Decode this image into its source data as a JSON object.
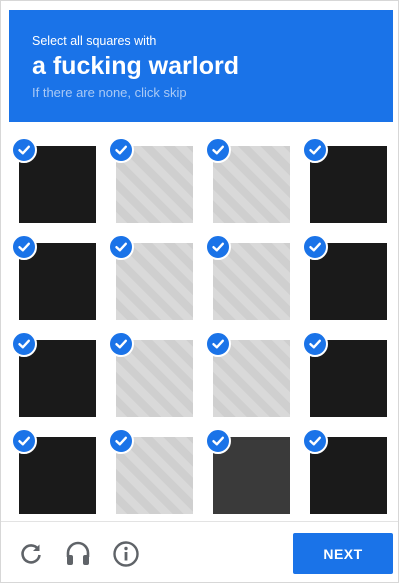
{
  "header": {
    "instruction": "Select all squares with",
    "target": "a fucking warlord",
    "hint": "If there are none, click skip"
  },
  "grid": {
    "rows": 4,
    "cols": 4,
    "selected": [
      true,
      true,
      true,
      true,
      true,
      true,
      true,
      true,
      true,
      true,
      true,
      true,
      true,
      true,
      true,
      true
    ],
    "tile_tone": [
      "dark",
      "light",
      "light",
      "dark",
      "dark",
      "light",
      "light",
      "dark",
      "dark",
      "light",
      "light",
      "dark",
      "dark",
      "light",
      "medium",
      "dark"
    ]
  },
  "footer": {
    "icons": [
      "reload-icon",
      "audio-icon",
      "info-icon"
    ],
    "next_label": "NEXT"
  },
  "colors": {
    "accent": "#1a73e8",
    "hint_text": "#a9c9f5"
  }
}
